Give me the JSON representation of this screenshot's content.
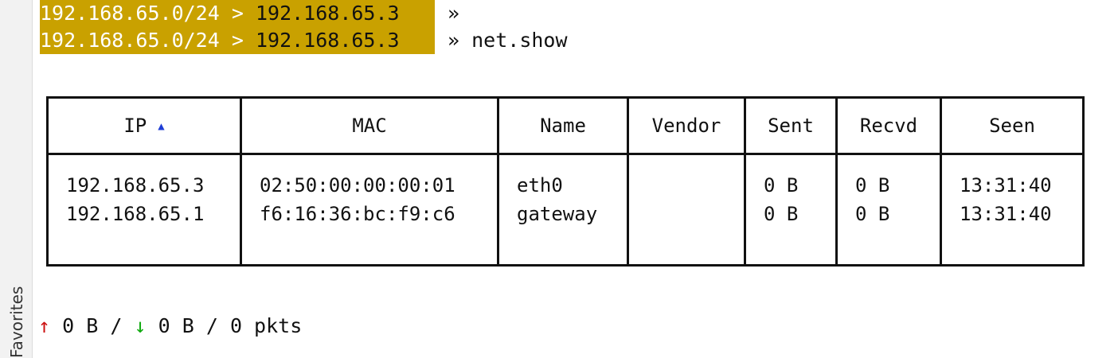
{
  "sidebar": {
    "label": "Favorites"
  },
  "prompt": {
    "lines": [
      {
        "network": "192.168.65.0/24",
        "separator": ">",
        "host": "192.168.65.3",
        "arrow": "»",
        "command": ""
      },
      {
        "network": "192.168.65.0/24",
        "separator": ">",
        "host": "192.168.65.3",
        "arrow": "»",
        "command": "net.show"
      }
    ],
    "highlight_color": "#c9a100"
  },
  "table": {
    "columns": [
      "IP",
      "MAC",
      "Name",
      "Vendor",
      "Sent",
      "Recvd",
      "Seen"
    ],
    "sort_indicator": "▲",
    "rows": [
      {
        "ip": "192.168.65.3",
        "mac": "02:50:00:00:00:01",
        "name": "eth0",
        "vendor": "",
        "sent": "0 B",
        "recvd": "0 B",
        "seen": "13:31:40"
      },
      {
        "ip": "192.168.65.1",
        "mac": "f6:16:36:bc:f9:c6",
        "name": "gateway",
        "vendor": "",
        "sent": "0 B",
        "recvd": "0 B",
        "seen": "13:31:40"
      }
    ]
  },
  "stats": {
    "up_icon": "↑",
    "sent": "0 B",
    "sep1": "/",
    "down_icon": "↓",
    "recvd": "0 B",
    "sep2": "/",
    "packets": "0 pkts",
    "up_color": "#cc1111",
    "down_color": "#11aa11"
  }
}
